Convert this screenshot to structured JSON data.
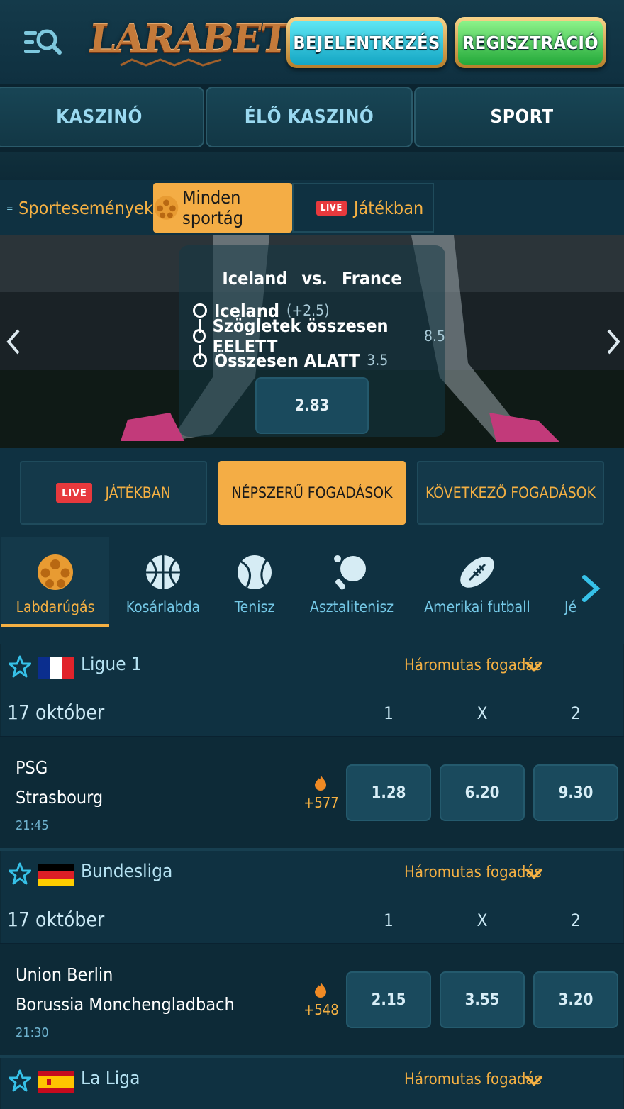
{
  "header": {
    "logo_text": "LARABET",
    "login_label": "BEJELENTKEZÉS",
    "register_label": "REGISZTRÁCIÓ"
  },
  "main_tabs": [
    {
      "label": "KASZINÓ",
      "active": false
    },
    {
      "label": "ÉLŐ KASZINÓ",
      "active": false
    },
    {
      "label": "SPORT",
      "active": true
    }
  ],
  "subnav": {
    "sports_events": "Sportesemények",
    "all_sports": "Minden sportág",
    "live_badge": "LIVE",
    "in_play": "Játékban"
  },
  "banner": {
    "home": "Iceland",
    "vs": "vs.",
    "away": "France",
    "selections": [
      {
        "label": "Iceland",
        "value": "(+2.5)"
      },
      {
        "label": "Szögletek összesen FELETT",
        "value": "8.5"
      },
      {
        "label": "Összesen ALATT",
        "value": "3.5"
      }
    ],
    "odd": "2.83"
  },
  "bet_tabs": {
    "live_badge": "LIVE",
    "in_play": "JÁTÉKBAN",
    "popular": "NÉPSZERŰ FOGADÁSOK",
    "next": "KÖVETKEZŐ FOGADÁSOK"
  },
  "sports": [
    {
      "label": "Labdarúgás",
      "icon": "soccer-ball-icon",
      "active": true
    },
    {
      "label": "Kosárlabda",
      "icon": "basketball-icon",
      "active": false
    },
    {
      "label": "Tenisz",
      "icon": "tennis-ball-icon",
      "active": false
    },
    {
      "label": "Asztalitenisz",
      "icon": "table-tennis-icon",
      "active": false
    },
    {
      "label": "Amerikai futball",
      "icon": "american-football-icon",
      "active": false
    },
    {
      "label": "Jé",
      "icon": "",
      "active": false
    }
  ],
  "leagues": [
    {
      "name": "Ligue 1",
      "flag": "france",
      "bet_type": "Háromutas fogadás",
      "date": "17 október",
      "cols": [
        "1",
        "X",
        "2"
      ],
      "match": {
        "home": "PSG",
        "away": "Strasbourg",
        "time": "21:45",
        "hot": "+577",
        "odds": [
          "1.28",
          "6.20",
          "9.30"
        ]
      }
    },
    {
      "name": "Bundesliga",
      "flag": "germany",
      "bet_type": "Háromutas fogadás",
      "date": "17 október",
      "cols": [
        "1",
        "X",
        "2"
      ],
      "match": {
        "home": "Union Berlin",
        "away": "Borussia Monchengladbach",
        "time": "21:30",
        "hot": "+548",
        "odds": [
          "2.15",
          "3.55",
          "3.20"
        ]
      }
    },
    {
      "name": "La Liga",
      "flag": "spain",
      "bet_type": "Háromutas fogadás"
    }
  ],
  "colors": {
    "accent": "#f4ad45",
    "background": "#0d2a37",
    "live": "#e7393d"
  }
}
